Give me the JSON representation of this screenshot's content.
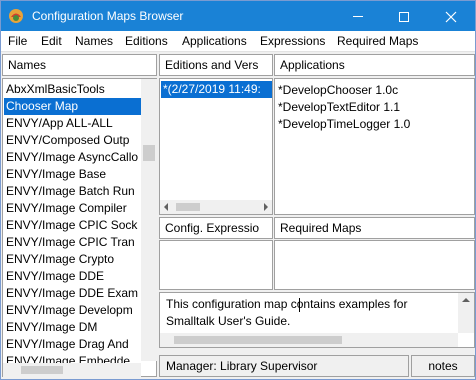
{
  "window": {
    "title": "Configuration Maps Browser",
    "accent": "#1a82d6",
    "selection_color": "#0a6fd2"
  },
  "titlebar_icons": {
    "app": "app-icon",
    "minimize": "minimize-icon",
    "maximize": "maximize-icon",
    "close": "close-icon"
  },
  "menu": {
    "items": [
      "File",
      "Edit",
      "Names",
      "Editions",
      "Applications",
      "Expressions",
      "Required Maps"
    ]
  },
  "names_pane": {
    "header": "Names",
    "items": [
      "AbxXmlBasicTools",
      "Chooser Map",
      "ENVY/App ALL-ALL",
      "ENVY/Composed Outp",
      "ENVY/Image AsyncCallo",
      "ENVY/Image Base",
      "ENVY/Image Batch Run",
      "ENVY/Image Compiler",
      "ENVY/Image CPIC Sock",
      "ENVY/Image CPIC Tran",
      "ENVY/Image Crypto",
      "ENVY/Image DDE",
      "ENVY/Image DDE Exam",
      "ENVY/Image Developm",
      "ENVY/Image DM",
      "ENVY/Image Drag And",
      "ENVY/Image Embedde"
    ],
    "selected_index": 1
  },
  "editions_pane": {
    "header": "Editions and Vers",
    "items": [
      "*(2/27/2019 11:49:"
    ],
    "selected_index": 0
  },
  "applications_pane": {
    "header": "Applications",
    "items": [
      "*DevelopChooser 1.0c",
      "*DevelopTextEditor 1.1",
      "*DevelopTimeLogger 1.0"
    ]
  },
  "config_expressions_pane": {
    "header": "Config. Expressio"
  },
  "required_maps_pane": {
    "header": "Required Maps"
  },
  "comment": {
    "line1": "This configuration map contains examples for",
    "line2": "Smalltalk User's Guide."
  },
  "status": {
    "manager": "Manager: Library Supervisor",
    "notes_button": "notes"
  }
}
